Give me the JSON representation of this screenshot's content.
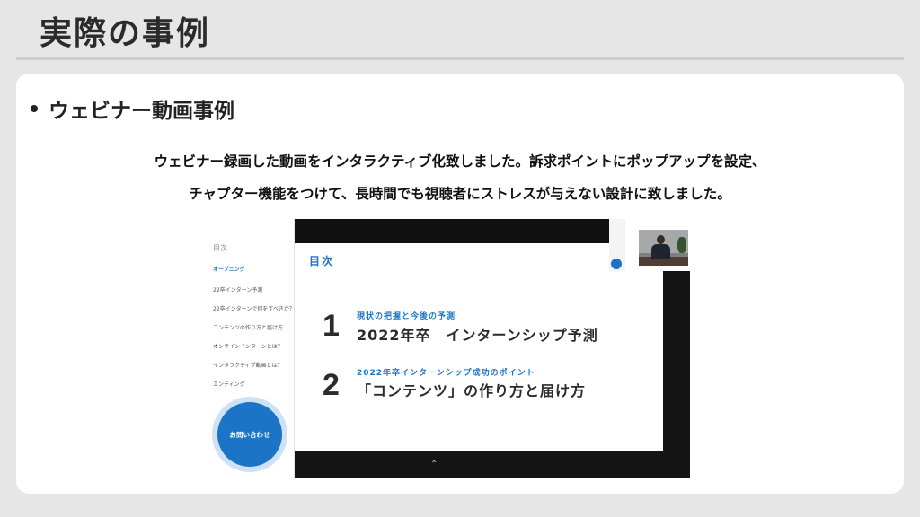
{
  "slide": {
    "title": "実際の事例",
    "bullet": "ウェビナー動画事例",
    "description_line1": "ウェビナー録画した動画をインタラクティブ化致しました。訴求ポイントにポップアップを設定、",
    "description_line2": "チャプター機能をつけて、長時間でも視聴者にストレスが与えない設計に致しました。"
  },
  "screenshot": {
    "toc": {
      "heading": "目次",
      "items": [
        "オープニング",
        "22卒インターン予測",
        "22卒インターンで何をすべきか？",
        "コンテンツの作り方と届け方",
        "オンラインインターンとは？",
        "インタラクティブ動画とは？",
        "エンディング"
      ],
      "active_index": 0
    },
    "contact_button": "お問い合わせ",
    "video": {
      "title": "目次",
      "chapters": [
        {
          "number": "1",
          "subtitle": "現状の把握と今後の予測",
          "main": "2022年卒　インターンシップ予測"
        },
        {
          "number": "2",
          "subtitle": "2022年卒インターンシップ成功のポイント",
          "main": "「コンテンツ」の作り方と届け方"
        }
      ],
      "collapse_icon": "chevron-up-icon"
    },
    "webcam_icon": "presenter-webcam-thumbnail"
  },
  "colors": {
    "accent_blue": "#1b74c5",
    "background": "#e6e6e6",
    "card": "#ffffff"
  }
}
